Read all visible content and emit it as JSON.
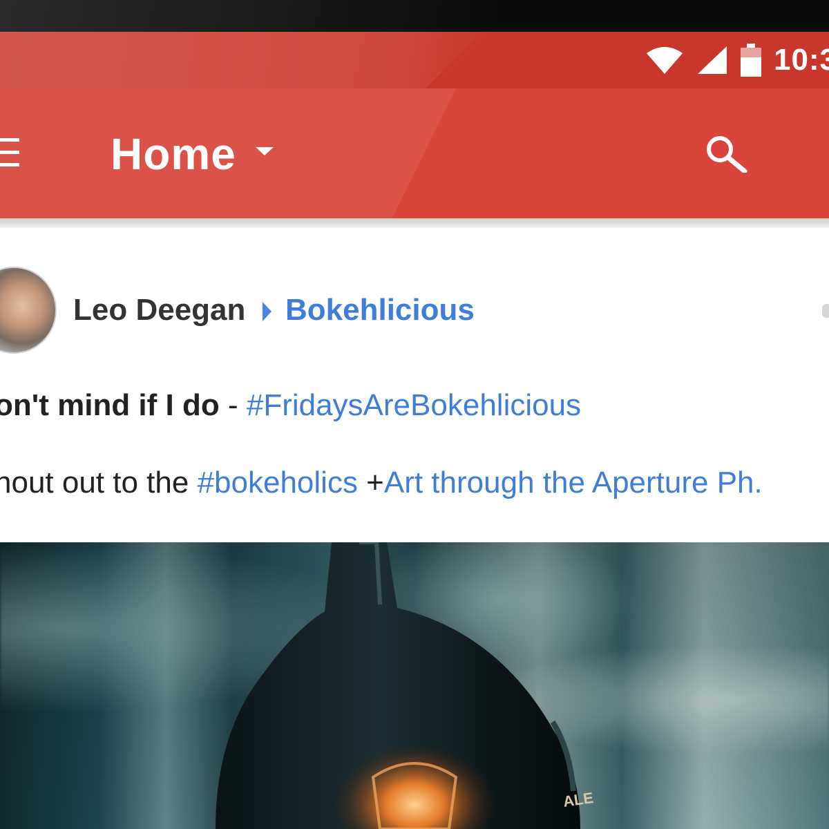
{
  "statusbar": {
    "time": "10:3",
    "icons": [
      "wifi-icon",
      "signal-icon",
      "battery-icon"
    ]
  },
  "appbar": {
    "title": "Home",
    "icons": [
      "menu-icon",
      "dropdown-icon",
      "search-icon"
    ]
  },
  "post": {
    "author": "Leo Deegan",
    "community": "Bokehlicious",
    "line1_text": "on't mind if I do",
    "line1_sep": " - ",
    "line1_tag": "#FridaysAreBokehlicious",
    "line2_text": "hout out to the ",
    "line2_tag": "#bokeholics",
    "line2_plus": " +",
    "line2_mention": "Art through the Aperture Ph.",
    "image_label": "ALE"
  },
  "colors": {
    "appbar": "#d9453b",
    "statusbar": "#c9362b",
    "link": "#3f7ddb"
  }
}
